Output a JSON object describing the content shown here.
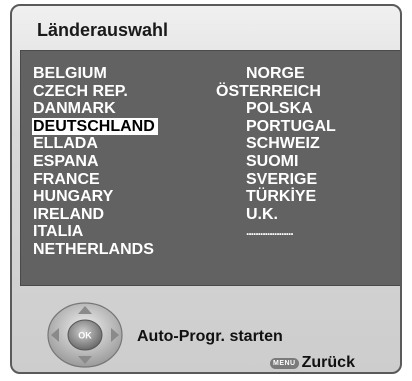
{
  "title": "Länderauswahl",
  "countries_left": [
    "BELGIUM",
    "CZECH REP.",
    "DANMARK",
    "DEUTSCHLAND",
    "ELLADA",
    "ESPANA",
    "FRANCE",
    "HUNGARY",
    "IRELAND",
    "ITALIA",
    "NETHERLANDS"
  ],
  "countries_right": [
    "NORGE",
    "ÖSTERREICH",
    "POLSKA",
    "PORTUGAL",
    "SCHWEIZ",
    "SUOMI",
    "SVERIGE",
    "TÜRKİYE",
    "U.K.",
    "...................."
  ],
  "selected_country": "DEUTSCHLAND",
  "nav": {
    "ok_label": "OK"
  },
  "hint": "Auto-Progr. starten",
  "back": {
    "key_label": "MENU",
    "label": "Zurück"
  },
  "colors": {
    "panel": "#626262",
    "frame": "#d0d0d0",
    "selected_bg": "#ffffff"
  }
}
